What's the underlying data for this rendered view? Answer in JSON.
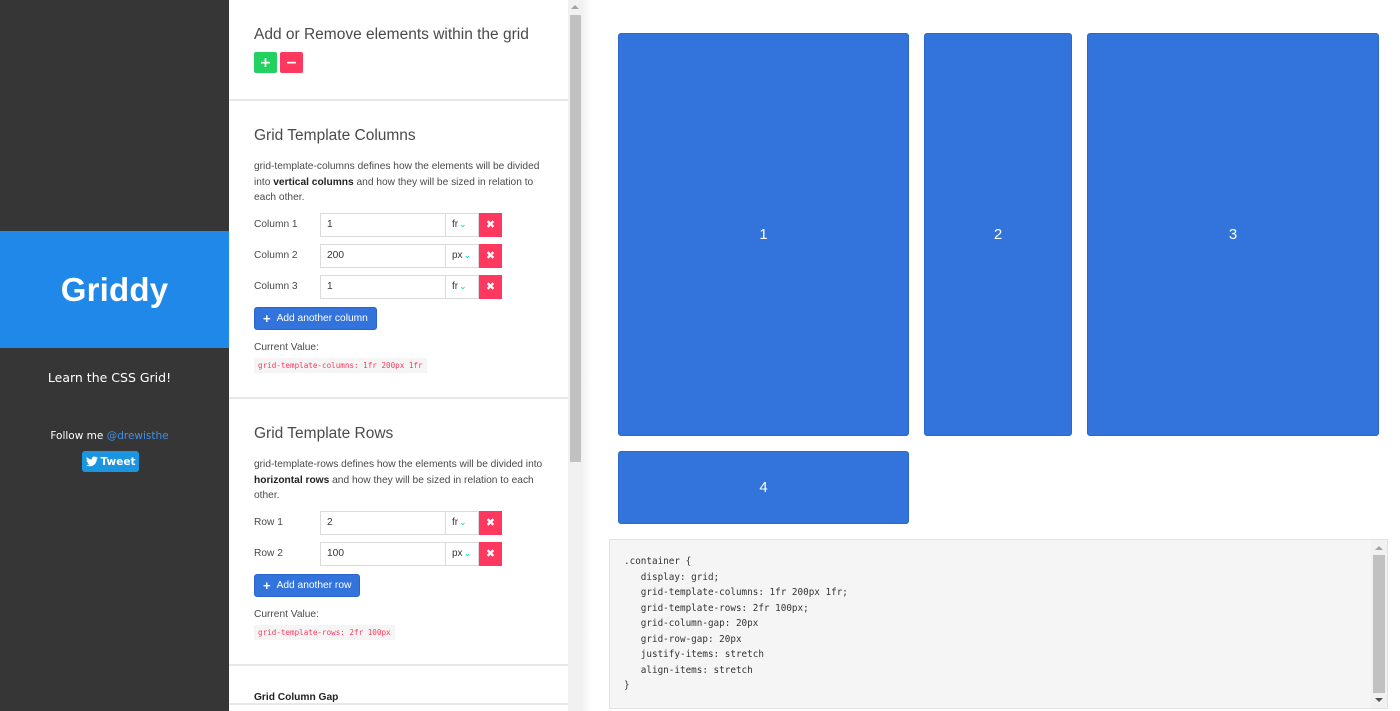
{
  "sidebar": {
    "brand": "Griddy",
    "tagline": "Learn the CSS Grid!",
    "follow_prefix": "Follow me ",
    "follow_handle": "@drewisthe",
    "tweet_label": "Tweet",
    "colors": {
      "background": "#363636",
      "brand": "#1f88e8",
      "tweet": "#1b95e0"
    }
  },
  "panel": {
    "add_remove": {
      "title": "Add or Remove elements within the grid",
      "add_icon": "plus-icon",
      "remove_icon": "minus-icon",
      "add_symbol": "+",
      "remove_symbol": "−"
    },
    "columns": {
      "title": "Grid Template Columns",
      "desc_pre": "grid-template-columns defines how the elements will be divided into ",
      "desc_bold": "vertical columns",
      "desc_post": " and how they will be sized in relation to each other.",
      "items": [
        {
          "label": "Column 1",
          "value": "1",
          "unit": "fr"
        },
        {
          "label": "Column 2",
          "value": "200",
          "unit": "px"
        },
        {
          "label": "Column 3",
          "value": "1",
          "unit": "fr"
        }
      ],
      "add_label": "Add another column",
      "current_label": "Current Value:",
      "current_value": "grid-template-columns: 1fr 200px 1fr"
    },
    "rows": {
      "title": "Grid Template Rows",
      "desc_pre": "grid-template-rows defines how the elements will be divided into ",
      "desc_bold": "horizontal rows",
      "desc_post": " and how they will be sized in relation to each other.",
      "items": [
        {
          "label": "Row 1",
          "value": "2",
          "unit": "fr"
        },
        {
          "label": "Row 2",
          "value": "100",
          "unit": "px"
        }
      ],
      "add_label": "Add another row",
      "current_label": "Current Value:",
      "current_value": "grid-template-rows: 2fr 100px"
    },
    "column_gap": {
      "title": "Grid Column Gap"
    },
    "remove_icon": "✖",
    "chevron": "✓"
  },
  "preview": {
    "items": [
      "1",
      "2",
      "3",
      "4"
    ],
    "item_color": "#3273dc",
    "css": ".container {\n   display: grid;\n   grid-template-columns: 1fr 200px 1fr;\n   grid-template-rows: 2fr 100px;\n   grid-column-gap: 20px\n   grid-row-gap: 20px\n   justify-items: stretch\n   align-items: stretch\n}"
  }
}
